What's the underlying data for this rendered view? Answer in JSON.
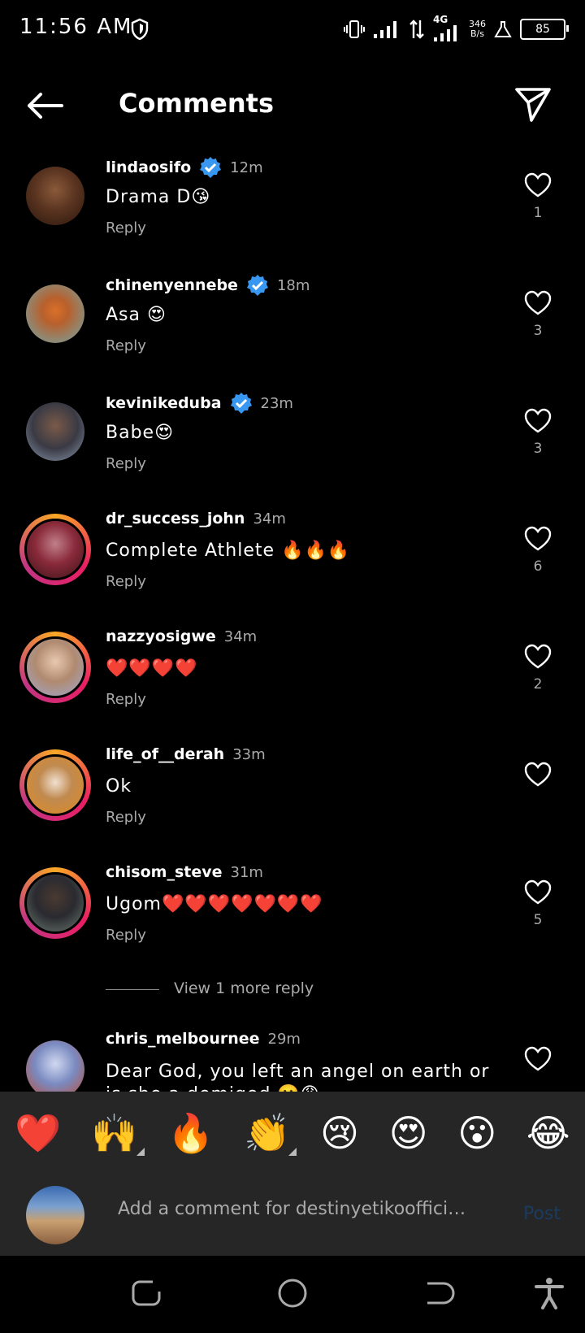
{
  "status": {
    "time": "11:56 AM",
    "network": "4G",
    "speed": "346",
    "speed_unit": "B/s",
    "battery": "85"
  },
  "header": {
    "title": "Comments"
  },
  "comments": [
    {
      "username": "lindaosifo",
      "verified": true,
      "time": "12m",
      "text": "Drama D😘",
      "reply": "Reply",
      "likes": "1",
      "story": false
    },
    {
      "username": "chinenyennebe",
      "verified": true,
      "time": "18m",
      "text": "Asa 😍",
      "reply": "Reply",
      "likes": "3",
      "story": false
    },
    {
      "username": "kevinikeduba",
      "verified": true,
      "time": "23m",
      "text": "Babe😍",
      "reply": "Reply",
      "likes": "3",
      "story": false
    },
    {
      "username": "dr_success_john",
      "verified": false,
      "time": "34m",
      "text": "Complete Athlete 🔥🔥🔥",
      "reply": "Reply",
      "likes": "6",
      "story": true
    },
    {
      "username": "nazzyosigwe",
      "verified": false,
      "time": "34m",
      "text": "❤️❤️❤️❤️",
      "reply": "Reply",
      "likes": "2",
      "story": true
    },
    {
      "username": "life_of__derah",
      "verified": false,
      "time": "33m",
      "text": "Ok",
      "reply": "Reply",
      "likes": "",
      "story": true
    },
    {
      "username": "chisom_steve",
      "verified": false,
      "time": "31m",
      "text": "Ugom❤️❤️❤️❤️❤️❤️❤️",
      "reply": "Reply",
      "likes": "5",
      "story": true
    },
    {
      "username": "chris_melbournee",
      "verified": false,
      "time": "29m",
      "text": "Dear God, you left an angel on earth or is she a demigod 🙂😩",
      "reply": "",
      "likes": "",
      "story": false
    }
  ],
  "view_more": "View 1 more reply",
  "emoji_bar": [
    "❤️",
    "🙌",
    "🔥",
    "👏",
    "😢",
    "😍",
    "😮",
    "😂"
  ],
  "composer": {
    "placeholder": "Add a comment for destinyetikoofficial...",
    "post_label": "Post"
  },
  "colors": {
    "background": "#000000",
    "panel": "#262626",
    "verified_blue": "#3897f0",
    "post_disabled": "#1b3b5f"
  }
}
